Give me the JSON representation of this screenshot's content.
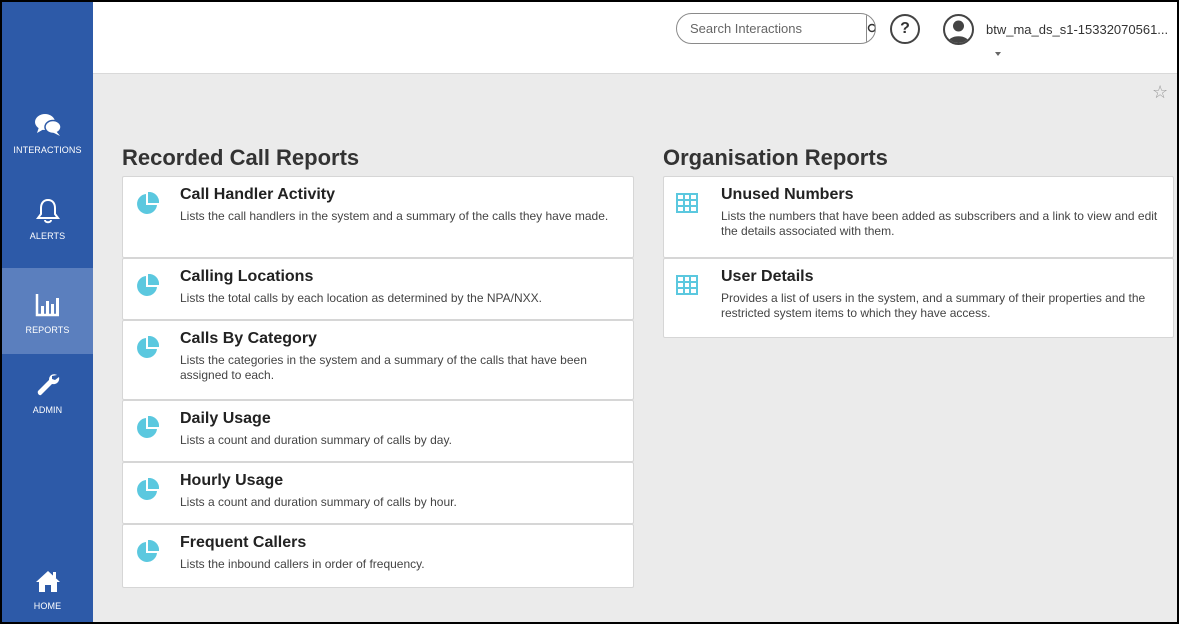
{
  "topbar": {
    "search_placeholder": "Search Interactions",
    "help_label": "?",
    "user_name": "btw_ma_ds_s1-15332070561..."
  },
  "sidebar": {
    "items": [
      {
        "label": "INTERACTIONS",
        "icon": "chat-bubbles-icon"
      },
      {
        "label": "ALERTS",
        "icon": "bell-icon"
      },
      {
        "label": "REPORTS",
        "icon": "bar-chart-icon",
        "active": true
      },
      {
        "label": "ADMIN",
        "icon": "wrench-icon"
      },
      {
        "label": "HOME",
        "icon": "home-icon"
      }
    ]
  },
  "favorite_icon": "☆",
  "recorded": {
    "title": "Recorded Call Reports",
    "reports": [
      {
        "title": "Call Handler Activity",
        "desc": "Lists the call handlers in the system and a summary of the calls they have made."
      },
      {
        "title": "Calling Locations",
        "desc": "Lists the total calls by each location as determined by the NPA/NXX."
      },
      {
        "title": "Calls By Category",
        "desc": "Lists the categories in the system and a summary of the calls that have been assigned to each."
      },
      {
        "title": "Daily Usage",
        "desc": "Lists a count and duration summary of calls by day."
      },
      {
        "title": "Hourly Usage",
        "desc": "Lists a count and duration summary of calls by hour."
      },
      {
        "title": "Frequent Callers",
        "desc": "Lists the inbound callers in order of frequency."
      }
    ]
  },
  "organisation": {
    "title": "Organisation Reports",
    "reports": [
      {
        "title": "Unused Numbers",
        "desc": "Lists the numbers that have been added as subscribers and a link to view and edit the details associated with them."
      },
      {
        "title": "User Details",
        "desc": "Provides a list of users in the system, and a summary of their properties and the restricted system items to which they have access."
      }
    ]
  },
  "colors": {
    "sidebar": "#2d5aa8",
    "sidebar_active": "#5b7fbe",
    "accent_icon": "#5bc8df",
    "background": "#ebebeb"
  }
}
